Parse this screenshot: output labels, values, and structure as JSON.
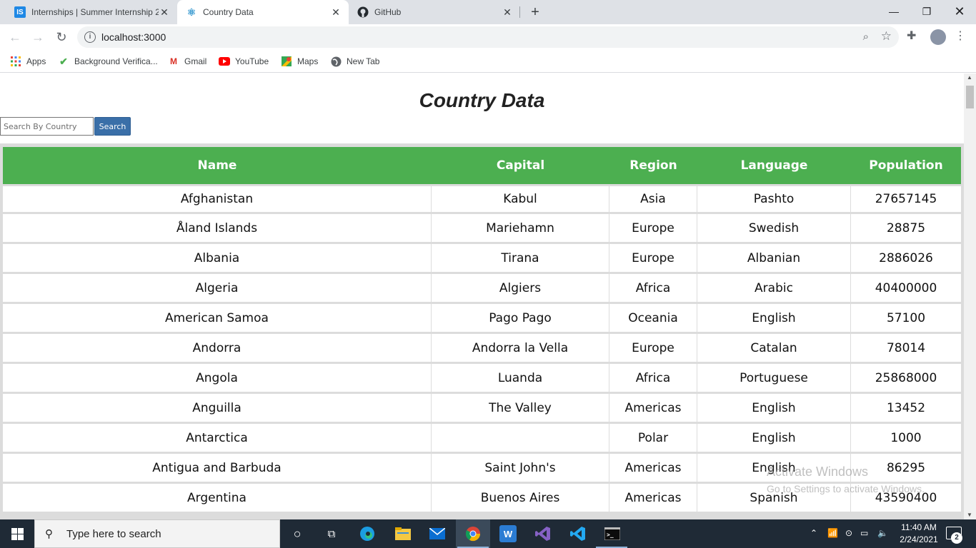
{
  "browser": {
    "tabs": [
      {
        "label": "Internships | Summer Internship 2",
        "favicon": "IS",
        "favicon_color": "#1e88e5"
      },
      {
        "label": "Country Data",
        "favicon": "⚛",
        "favicon_color": "#61dafb"
      },
      {
        "label": "GitHub",
        "favicon": "github-icon",
        "favicon_color": "#24292e"
      }
    ],
    "url": "localhost:3000",
    "bookmarks": [
      {
        "label": "Apps",
        "icon": "apps-grid-icon"
      },
      {
        "label": "Background Verifica...",
        "icon": "checkmark-icon"
      },
      {
        "label": "Gmail",
        "icon": "gmail-icon"
      },
      {
        "label": "YouTube",
        "icon": "youtube-icon"
      },
      {
        "label": "Maps",
        "icon": "maps-icon"
      },
      {
        "label": "New Tab",
        "icon": "globe-icon"
      }
    ]
  },
  "page": {
    "title": "Country Data",
    "search_placeholder": "Search By Country",
    "search_button": "Search"
  },
  "table": {
    "headers": [
      "Name",
      "Capital",
      "Region",
      "Language",
      "Population"
    ],
    "rows": [
      [
        "Afghanistan",
        "Kabul",
        "Asia",
        "Pashto",
        "27657145"
      ],
      [
        "Åland Islands",
        "Mariehamn",
        "Europe",
        "Swedish",
        "28875"
      ],
      [
        "Albania",
        "Tirana",
        "Europe",
        "Albanian",
        "2886026"
      ],
      [
        "Algeria",
        "Algiers",
        "Africa",
        "Arabic",
        "40400000"
      ],
      [
        "American Samoa",
        "Pago Pago",
        "Oceania",
        "English",
        "57100"
      ],
      [
        "Andorra",
        "Andorra la Vella",
        "Europe",
        "Catalan",
        "78014"
      ],
      [
        "Angola",
        "Luanda",
        "Africa",
        "Portuguese",
        "25868000"
      ],
      [
        "Anguilla",
        "The Valley",
        "Americas",
        "English",
        "13452"
      ],
      [
        "Antarctica",
        "",
        "Polar",
        "English",
        "1000"
      ],
      [
        "Antigua and Barbuda",
        "Saint John's",
        "Americas",
        "English",
        "86295"
      ],
      [
        "Argentina",
        "Buenos Aires",
        "Americas",
        "Spanish",
        "43590400"
      ]
    ],
    "header_color": "#4caf50"
  },
  "watermark": {
    "line1": "Activate Windows",
    "line2": "Go to Settings to activate Windows."
  },
  "taskbar": {
    "search_placeholder": "Type here to search",
    "time": "11:40 AM",
    "date": "2/24/2021",
    "notification_count": "2"
  }
}
